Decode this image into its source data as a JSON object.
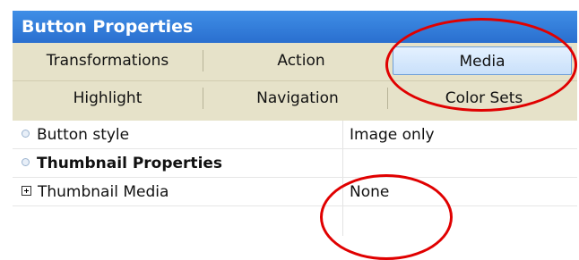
{
  "panel": {
    "title": "Button Properties"
  },
  "tabs": {
    "row1": [
      {
        "label": "Transformations",
        "selected": false
      },
      {
        "label": "Action",
        "selected": false
      },
      {
        "label": "Media",
        "selected": true
      }
    ],
    "row2": [
      {
        "label": "Highlight"
      },
      {
        "label": "Navigation"
      },
      {
        "label": "Color Sets"
      }
    ]
  },
  "properties": [
    {
      "name": "Button style",
      "value": "Image only",
      "icon": "bullet-icon"
    },
    {
      "name": "Thumbnail Properties",
      "value": "",
      "icon": "bullet-icon",
      "section": true
    },
    {
      "name": "Thumbnail Media",
      "value": "None",
      "icon": "expand-plus-icon"
    }
  ],
  "annotation_color": "#e00000",
  "accent_color": "#2a6fcf"
}
